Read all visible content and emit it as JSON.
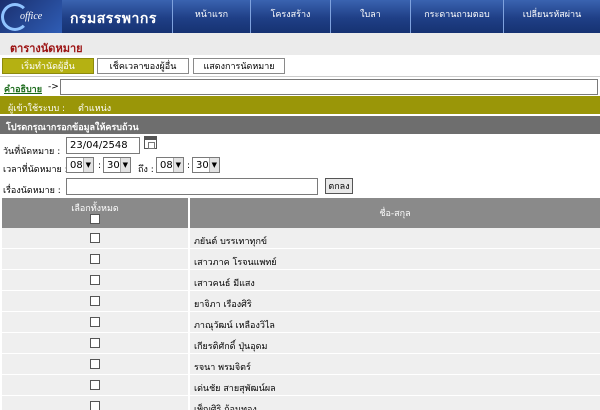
{
  "app": {
    "logo_text": "office",
    "title": "กรมสรรพากร"
  },
  "nav": [
    {
      "label": "หน้าแรก"
    },
    {
      "label": "โครงสร้าง"
    },
    {
      "label": "ใบลา"
    },
    {
      "label": "กระดานถามตอบ"
    },
    {
      "label": "เปลี่ยนรหัสผ่าน"
    }
  ],
  "page_title": "ตารางนัดหมาย",
  "tabs": [
    {
      "label": "เริ่มทำนัดผู้อื่น",
      "active": true
    },
    {
      "label": "เช็คเวลาของผู้อื่น",
      "active": false
    },
    {
      "label": "แสดงการนัดหมาย",
      "active": false
    }
  ],
  "description": {
    "label": "คำอธิบาย",
    "arrow": "->",
    "value": ""
  },
  "user_bar": {
    "user_label": "ผู้เข้าใช้ระบบ :",
    "position_label": "ตำแหน่ง"
  },
  "form": {
    "header": "โปรดกรุณากรอกข้อมูลให้ครบถ้วน",
    "date_label": "วันที่นัดหมาย :",
    "date_value": "23/04/2548",
    "time_label": "เวลาที่นัดหมาย :",
    "start_hour": "08",
    "start_minute": "30",
    "to_label": "ถึง :",
    "end_hour": "08",
    "end_minute": "30",
    "subject_label": "เรื่องนัดหมาย :",
    "subject_value": "",
    "ok_label": "ตกลง",
    "colon": ":"
  },
  "table": {
    "select_all_label": "เลือกทั้งหมด",
    "name_header": "ชื่อ-สกุล",
    "rows": [
      {
        "name": "ภยันต์ บรรเทาทุกข์"
      },
      {
        "name": "เสาวภาค โรจนแพทย์"
      },
      {
        "name": "เสาวคนธ์ มีแสง"
      },
      {
        "name": "ยาจิภา เรืองศิริ"
      },
      {
        "name": "ภาณุวัฒน์ เหลืองวิไล"
      },
      {
        "name": "เกียรติศักดิ์ ปุ่นอุดม"
      },
      {
        "name": "รจนา พรมจิตร์"
      },
      {
        "name": "เด่นชัย สายสุพัฒน์ผล"
      },
      {
        "name": "เพ็ญศิริ ก้อนทอง"
      }
    ]
  },
  "colors": {
    "nav_bg": "#1f3f86",
    "olive": "#9a9608",
    "tab_active": "#b5b112",
    "title_red": "#9c1212",
    "link_green": "#1a6a1a"
  }
}
